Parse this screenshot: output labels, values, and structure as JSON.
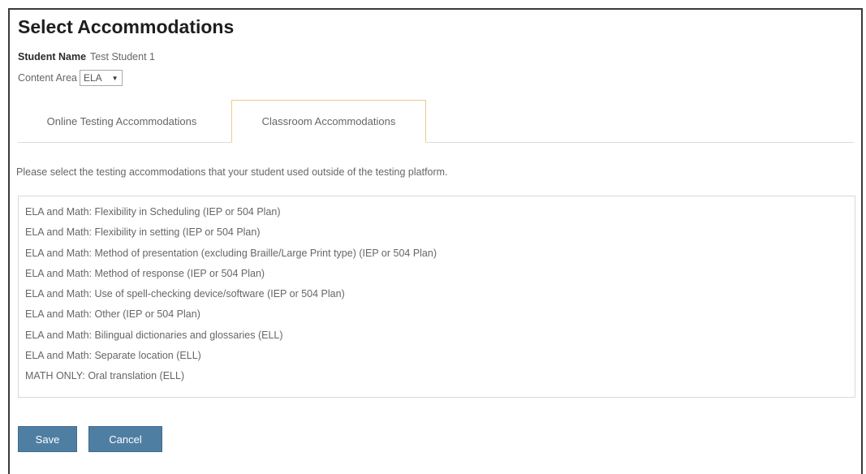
{
  "page": {
    "title": "Select Accommodations",
    "student_name_label": "Student Name",
    "student_name_value": "Test Student 1",
    "content_area_label": "Content Area",
    "content_area_value": "ELA"
  },
  "tabs": [
    {
      "label": "Online Testing Accommodations",
      "active": false
    },
    {
      "label": "Classroom Accommodations",
      "active": true
    }
  ],
  "instructions": "Please select the testing accommodations that your student used outside of the testing platform.",
  "accommodations": [
    "ELA and Math: Flexibility in Scheduling (IEP or 504 Plan)",
    "ELA and Math: Flexibility in setting (IEP or 504 Plan)",
    "ELA and Math: Method of presentation (excluding Braille/Large Print type) (IEP or 504 Plan)",
    "ELA and Math: Method of response (IEP or 504 Plan)",
    "ELA and Math: Use of spell-checking device/software (IEP or 504 Plan)",
    "ELA and Math: Other (IEP or 504 Plan)",
    "ELA and Math: Bilingual dictionaries and glossaries (ELL)",
    "ELA and Math: Separate location (ELL)",
    "MATH ONLY: Oral translation (ELL)"
  ],
  "buttons": {
    "save": "Save",
    "cancel": "Cancel"
  },
  "colors": {
    "button_bg": "#4f7ea3",
    "active_tab_border": "#f0c98a",
    "frame_border": "#3a3a3a"
  },
  "icons": {
    "dropdown": "caret-down-icon"
  }
}
